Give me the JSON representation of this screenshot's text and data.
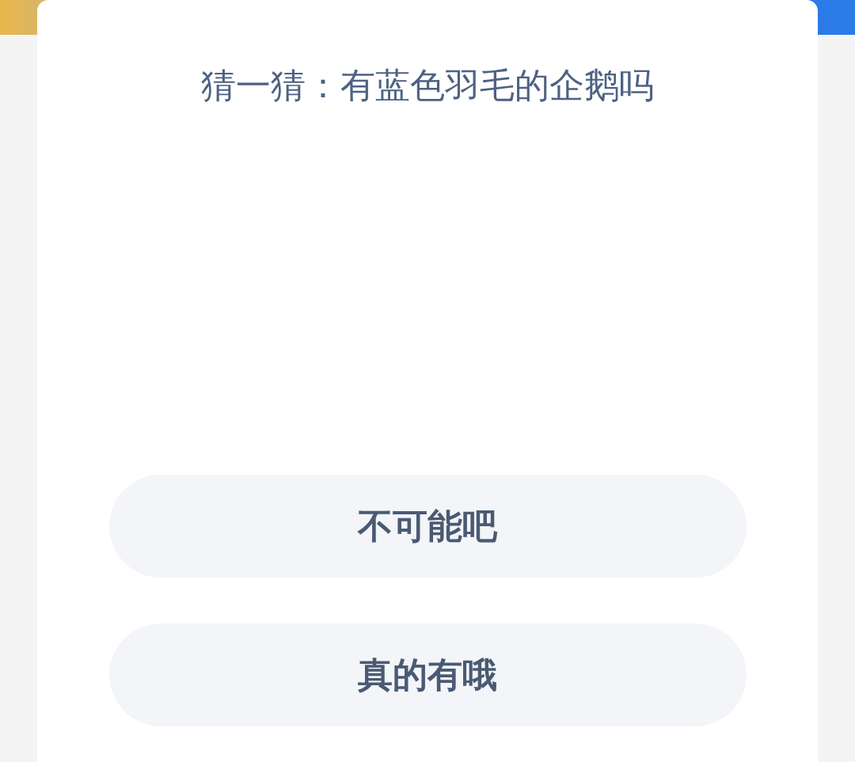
{
  "question": "猜一猜：有蓝色羽毛的企鹅吗",
  "options": [
    {
      "label": "不可能吧"
    },
    {
      "label": "真的有哦"
    }
  ]
}
